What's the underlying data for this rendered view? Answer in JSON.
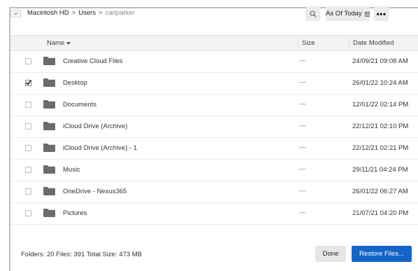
{
  "breadcrumb": {
    "root": "Macintosh HD",
    "sep1": ">",
    "users": "Users",
    "sep2": ">",
    "current": "carlparker"
  },
  "toolbar": {
    "as_of_label": "As Of Today",
    "more_label": "•••"
  },
  "columns": {
    "name": "Name",
    "size": "Size",
    "date": "Date Modified"
  },
  "rows": [
    {
      "name": "Creative Cloud Files",
      "size": "—",
      "date": "24/09/21 09:08 AM",
      "checked": false
    },
    {
      "name": "Desktop",
      "size": "—",
      "date": "26/01/22 10:24 AM",
      "checked": true
    },
    {
      "name": "Documents",
      "size": "—",
      "date": "12/01/22 02:14 PM",
      "checked": false
    },
    {
      "name": "iCloud Drive (Archive)",
      "size": "—",
      "date": "22/12/21 02:10 PM",
      "checked": false
    },
    {
      "name": "iCloud Drive (Archive) - 1",
      "size": "—",
      "date": "22/12/21 02:21 PM",
      "checked": false
    },
    {
      "name": "Music",
      "size": "—",
      "date": "29/11/21 04:24 PM",
      "checked": false
    },
    {
      "name": "OneDrive - Nexus365",
      "size": "—",
      "date": "26/01/22 06:27 AM",
      "checked": false
    },
    {
      "name": "Pictures",
      "size": "—",
      "date": "21/07/21 04:20 PM",
      "checked": false
    }
  ],
  "footer": {
    "summary": "Folders: 20  Files: 391  Total Size: 473 MB",
    "done_label": "Done",
    "restore_label": "Restore Files..."
  },
  "colors": {
    "accent": "#1565c9",
    "folder": "#6b6b6b",
    "header_bg": "#f3f3f3"
  },
  "icons": {
    "search": "search-icon",
    "calendar": "calendar-icon",
    "folder": "folder-icon",
    "sort": "sort-down-icon",
    "chevron": "chevron-down-icon"
  }
}
